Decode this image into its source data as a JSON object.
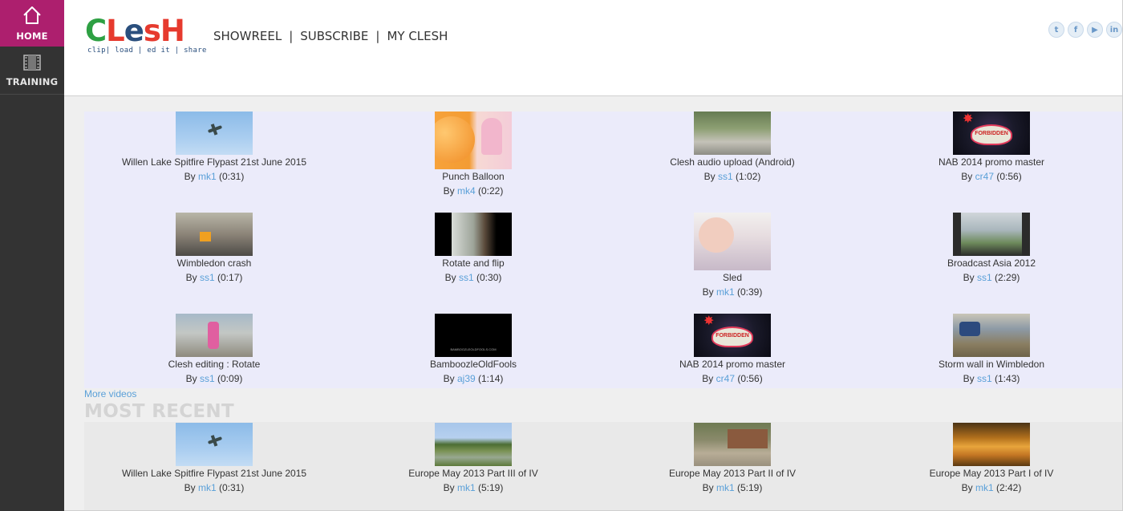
{
  "sidebar": {
    "items": [
      {
        "label": "HOME",
        "icon": "home-icon"
      },
      {
        "label": "TRAINING",
        "icon": "film-icon"
      }
    ]
  },
  "header": {
    "logo": {
      "text": "Clesh",
      "tagline": "clip| load | ed it | share"
    },
    "nav": [
      "SHOWREEL",
      "SUBSCRIBE",
      "MY CLESH"
    ],
    "nav_separator": "|",
    "social": [
      {
        "icon": "twitter-icon",
        "glyph": "t"
      },
      {
        "icon": "facebook-icon",
        "glyph": "f"
      },
      {
        "icon": "youtube-icon",
        "glyph": "▶"
      },
      {
        "icon": "linkedin-icon",
        "glyph": "in"
      }
    ]
  },
  "colors": {
    "home_accent": "#ad1f6e",
    "sidebar_bg": "#333333",
    "link": "#5aa0d8",
    "grid_bg": "#ebebfa"
  },
  "videos": [
    {
      "title": "Willen Lake Spitfire Flypast 21st June 2015",
      "by": "By",
      "user": "mk1",
      "duration": "(0:31)"
    },
    {
      "title": "Punch Balloon",
      "by": "By",
      "user": "mk4",
      "duration": "(0:22)"
    },
    {
      "title": "Clesh audio upload (Android)",
      "by": "By",
      "user": "ss1",
      "duration": "(1:02)"
    },
    {
      "title": "NAB 2014 promo master",
      "by": "By",
      "user": "cr47",
      "duration": "(0:56)"
    },
    {
      "title": "Wimbledon crash",
      "by": "By",
      "user": "ss1",
      "duration": "(0:17)"
    },
    {
      "title": "Rotate and flip",
      "by": "By",
      "user": "ss1",
      "duration": "(0:30)"
    },
    {
      "title": "Sled",
      "by": "By",
      "user": "mk1",
      "duration": "(0:39)"
    },
    {
      "title": "Broadcast Asia 2012",
      "by": "By",
      "user": "ss1",
      "duration": "(2:29)"
    },
    {
      "title": "Clesh editing : Rotate",
      "by": "By",
      "user": "ss1",
      "duration": "(0:09)"
    },
    {
      "title": "BamboozleOldFools",
      "by": "By",
      "user": "aj39",
      "duration": "(1:14)",
      "thumb_caption": "BAMBOOZLEOLDFOOLS.COM"
    },
    {
      "title": "NAB 2014 promo master",
      "by": "By",
      "user": "cr47",
      "duration": "(0:56)"
    },
    {
      "title": "Storm wall in Wimbledon",
      "by": "By",
      "user": "ss1",
      "duration": "(1:43)"
    }
  ],
  "more_videos": "More videos",
  "recent": {
    "heading": "MOST RECENT",
    "videos": [
      {
        "title": "Willen Lake Spitfire Flypast 21st June 2015",
        "by": "By",
        "user": "mk1",
        "duration": "(0:31)"
      },
      {
        "title": "Europe May 2013 Part III of IV",
        "by": "By",
        "user": "mk1",
        "duration": "(5:19)"
      },
      {
        "title": "Europe May 2013 Part II of IV",
        "by": "By",
        "user": "mk1",
        "duration": "(5:19)"
      },
      {
        "title": "Europe May 2013 Part I of IV",
        "by": "By",
        "user": "mk1",
        "duration": "(2:42)"
      }
    ]
  }
}
